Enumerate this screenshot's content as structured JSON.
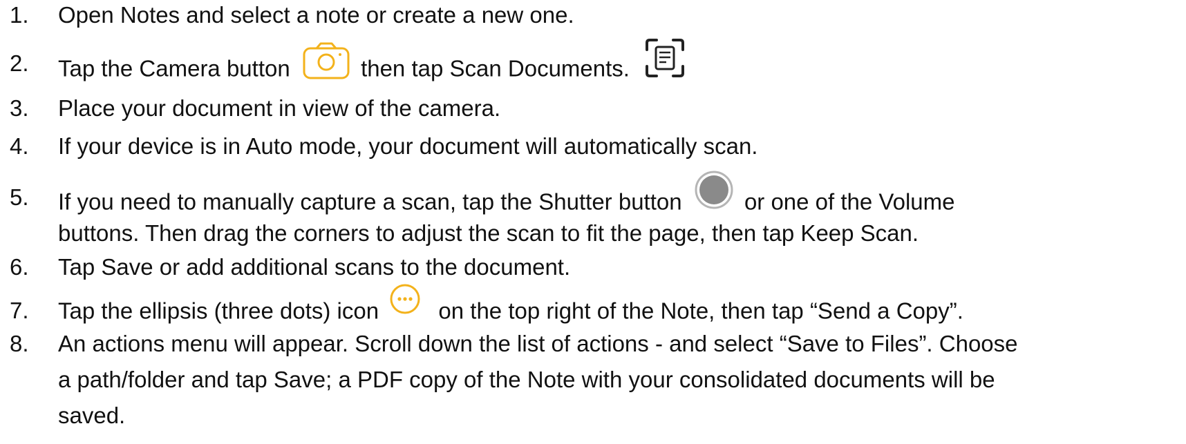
{
  "steps": [
    {
      "num": "1.",
      "text": "Open Notes and select a note or create a new one."
    },
    {
      "num": "2.",
      "text_a": "Tap the Camera button",
      "text_b": "then tap Scan Documents.",
      "icon_a": "camera-icon",
      "icon_b": "scan-documents-icon"
    },
    {
      "num": "3.",
      "text": "Place your document in view of the camera."
    },
    {
      "num": "4.",
      "text": "If your device is in Auto mode, your document will automatically scan."
    },
    {
      "num": "5.",
      "text_a": "If you need to manually capture a scan, tap the Shutter button",
      "text_b": "or one of the Volume",
      "line2": "buttons. Then drag the corners to adjust the scan to fit the page, then tap Keep Scan.",
      "icon": "shutter-icon"
    },
    {
      "num": "6.",
      "text": "Tap Save or add additional scans to the document."
    },
    {
      "num": "7.",
      "text_a": "Tap the ellipsis (three dots) icon",
      "text_b": "on the top right of the Note, then tap “Send a Copy”.",
      "icon": "ellipsis-icon"
    },
    {
      "num": "8.",
      "line1": "An actions menu will appear.  Scroll down the list of actions - and select “Save to Files”.  Choose",
      "line2": "a path/folder and tap Save; a PDF copy of the Note with your consolidated documents will be",
      "line3": "saved."
    }
  ],
  "colors": {
    "text": "#111111",
    "accent_yellow": "#F3B21B",
    "shutter_gray": "#8a8a8a",
    "icon_dark": "#222222"
  }
}
